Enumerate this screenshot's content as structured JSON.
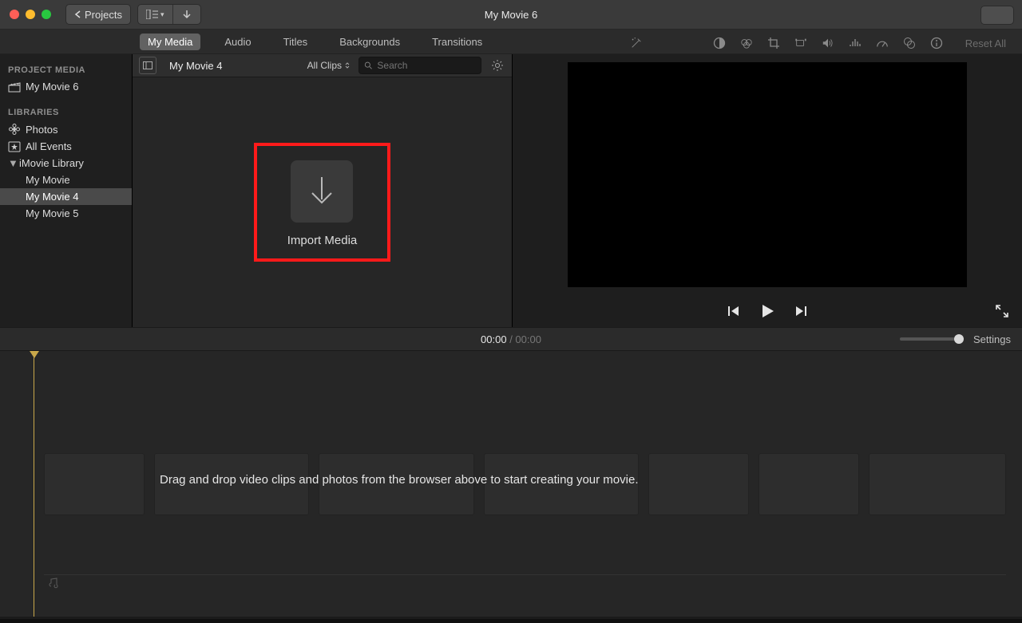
{
  "window": {
    "title": "My Movie 6",
    "back_label": "Projects"
  },
  "tabs": {
    "my_media": "My Media",
    "audio": "Audio",
    "titles": "Titles",
    "backgrounds": "Backgrounds",
    "transitions": "Transitions"
  },
  "toolstrip": {
    "reset_all": "Reset All"
  },
  "sidebar": {
    "project_media_header": "PROJECT MEDIA",
    "project_name": "My Movie 6",
    "libraries_header": "LIBRARIES",
    "photos": "Photos",
    "all_events": "All Events",
    "imovie_library": "iMovie Library",
    "events": [
      {
        "label": "My Movie"
      },
      {
        "label": "My Movie 4"
      },
      {
        "label": "My Movie 5"
      }
    ]
  },
  "browser": {
    "event_title": "My Movie 4",
    "clip_filter": "All Clips",
    "search_placeholder": "Search",
    "import_label": "Import Media"
  },
  "timecode": {
    "current": "00:00",
    "total": "00:00",
    "settings": "Settings"
  },
  "timeline": {
    "hint": "Drag and drop video clips and photos from the browser above to start creating your movie."
  }
}
